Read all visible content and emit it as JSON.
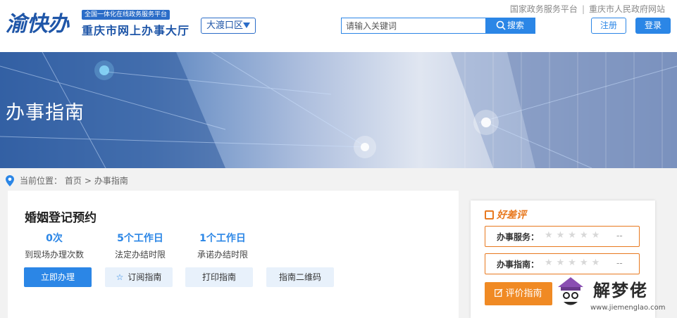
{
  "header": {
    "logo_text": "渝快办",
    "logo_tag": "全国一体化在线政务服务平台",
    "logo_sub": "重庆市网上办事大厅",
    "region": "大渡口区",
    "search_placeholder": "请输入关键词",
    "search_button": "搜索",
    "top_links": [
      "国家政务服务平台",
      "重庆市人民政府网站"
    ],
    "register": "注册",
    "login": "登录"
  },
  "banner": {
    "title": "办事指南"
  },
  "breadcrumb": {
    "label": "当前位置：",
    "items": [
      "首页",
      "办事指南"
    ],
    "separator": ">"
  },
  "service": {
    "title": "婚姻登记预约",
    "stats": [
      {
        "value": "0次",
        "label": "到现场办理次数"
      },
      {
        "value": "5个工作日",
        "label": "法定办结时限"
      },
      {
        "value": "1个工作日",
        "label": "承诺办结时限"
      }
    ],
    "actions": [
      "立即办理",
      "订阅指南",
      "打印指南",
      "指南二维码"
    ]
  },
  "rating": {
    "title": "好差评",
    "rows": [
      {
        "label": "办事服务：",
        "stars": "★★★★★",
        "value": "--"
      },
      {
        "label": "办事指南：",
        "stars": "★★★★★",
        "value": "--"
      }
    ],
    "button": "评价指南"
  },
  "watermark": {
    "text": "解梦佬",
    "url": "www.jiemenglao.com"
  },
  "colors": {
    "primary": "#2b86e6",
    "brand": "#1f56a8",
    "orange": "#f08a24"
  }
}
